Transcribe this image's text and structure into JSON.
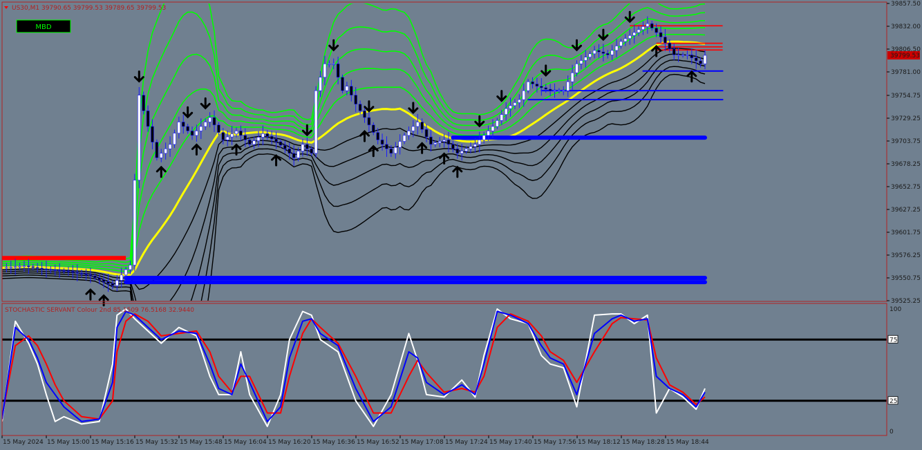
{
  "header": {
    "symbol_line": "US30,M1  39790.65 39799.53 39789.65 39799.53",
    "mbd_button": "MBD",
    "indicator_label": "STOCHASTIC SERVANT Colour 2nd 85.1509 76.5168 32.9440"
  },
  "colors": {
    "background": "#708090",
    "frame": "#b22222",
    "band_upper": "#00ff00",
    "band_mid": "#ffff00",
    "band_lower": "#000000",
    "candle": "#1a1aff",
    "level_blue": "#0000ff",
    "level_red": "#ff0000",
    "stoch_main": "#0000ff",
    "stoch_signal": "#ff0000",
    "stoch_raw": "#ffffff"
  },
  "chart_data": [
    {
      "type": "line",
      "title": "",
      "ylim": [
        39525.25,
        39857.5
      ],
      "y_ticks": [
        "39857.50",
        "39832.00",
        "39806.50",
        "39781.00",
        "39754.75",
        "39729.25",
        "39703.75",
        "39678.25",
        "39652.75",
        "39627.25",
        "39601.75",
        "39576.25",
        "39550.75",
        "39525.25"
      ],
      "x_ticks": [
        "15 May 2024",
        "15 May 15:00",
        "15 May 15:16",
        "15 May 15:32",
        "15 May 15:48",
        "15 May 16:04",
        "15 May 16:20",
        "15 May 16:36",
        "15 May 16:52",
        "15 May 17:08",
        "15 May 17:24",
        "15 May 17:40",
        "15 May 17:56",
        "15 May 18:12",
        "15 May 18:28",
        "15 May 18:44"
      ],
      "current_price": "39799.53",
      "price_path": {
        "x": [
          0,
          5,
          10,
          15,
          20,
          25,
          28,
          29,
          31,
          33,
          35,
          38,
          40,
          43,
          47,
          50,
          53,
          56,
          59,
          62,
          64,
          66,
          68,
          70,
          71,
          73,
          75,
          77,
          78,
          80,
          82,
          85,
          88,
          91,
          94,
          97,
          100,
          103,
          107,
          111,
          114,
          117,
          119,
          121,
          124,
          127,
          130,
          134,
          137,
          140,
          143,
          146,
          149,
          152,
          155,
          158,
          159
        ],
        "close": [
          39562,
          39564,
          39560,
          39558,
          39553,
          39542,
          39560,
          39565,
          39755,
          39720,
          39685,
          39700,
          39725,
          39710,
          39730,
          39705,
          39715,
          39700,
          39712,
          39703,
          39695,
          39685,
          39700,
          39690,
          39760,
          39790,
          39790,
          39760,
          39765,
          39745,
          39730,
          39705,
          39690,
          39710,
          39725,
          39700,
          39705,
          39690,
          39700,
          39720,
          39740,
          39750,
          39770,
          39765,
          39760,
          39760,
          39790,
          39805,
          39800,
          39815,
          39825,
          39835,
          39820,
          39800,
          39800,
          39790,
          39799.53
        ]
      },
      "bands_upper": [
        1.0,
        0.78,
        0.58,
        0.4,
        0.22
      ],
      "band_mid": 0,
      "bands_lower": [
        -0.2,
        -0.38,
        -0.56,
        -0.76,
        -1.0
      ],
      "levels_blue": [
        {
          "price": 39550.75,
          "x_from": 28,
          "x_to": 159
        },
        {
          "price": 39546.0,
          "x_from": 28,
          "x_to": 159
        },
        {
          "price": 39707.5,
          "x_from": 102,
          "x_to": 159
        },
        {
          "price": 39750.0,
          "x_from": 119,
          "x_to": 163
        },
        {
          "price": 39760.0,
          "x_from": 122,
          "x_to": 163
        },
        {
          "price": 39782.0,
          "x_from": 145,
          "x_to": 163
        }
      ],
      "levels_red": [
        {
          "price": 39573.0,
          "x_from": 0,
          "x_to": 28
        },
        {
          "price": 39832.5,
          "x_from": 142,
          "x_to": 163
        },
        {
          "price": 39813.0,
          "x_from": 148,
          "x_to": 163
        },
        {
          "price": 39809.0,
          "x_from": 148,
          "x_to": 163
        },
        {
          "price": 39805.5,
          "x_from": 148,
          "x_to": 163
        }
      ],
      "arrows_down": [
        31,
        42,
        46,
        69,
        75,
        83,
        93,
        108,
        113,
        123,
        130,
        136,
        142
      ],
      "arrows_up": [
        20,
        23,
        36,
        44,
        53,
        62,
        82,
        84,
        95,
        100,
        103,
        148,
        156
      ]
    },
    {
      "type": "line",
      "title": "",
      "ylim": [
        0,
        100
      ],
      "y_ticks": [
        "100",
        "75",
        "25",
        "0"
      ],
      "levels": [
        75,
        25
      ],
      "series": [
        {
          "x": [
            0,
            3,
            6,
            8,
            10,
            12,
            14,
            18,
            22,
            25,
            26,
            28,
            30,
            33,
            36,
            40,
            44,
            47,
            49,
            52,
            54,
            56,
            60,
            63,
            65,
            68,
            70,
            72,
            76,
            80,
            84,
            88,
            92,
            94,
            96,
            100,
            104,
            107,
            109,
            112,
            115,
            119,
            122,
            124,
            127,
            130,
            134,
            138,
            140,
            143,
            146,
            148,
            151,
            154,
            157,
            159
          ],
          "values": [
            10,
            85,
            75,
            60,
            40,
            30,
            20,
            8,
            10,
            40,
            85,
            98,
            95,
            85,
            75,
            82,
            80,
            55,
            35,
            30,
            55,
            40,
            8,
            20,
            60,
            90,
            92,
            80,
            70,
            35,
            8,
            20,
            65,
            60,
            40,
            30,
            38,
            30,
            55,
            98,
            95,
            88,
            70,
            60,
            55,
            30,
            80,
            92,
            95,
            90,
            92,
            45,
            35,
            30,
            20,
            32
          ]
        },
        {
          "x": [
            0,
            3,
            6,
            8,
            10,
            12,
            14,
            18,
            22,
            25,
            26,
            28,
            30,
            33,
            36,
            40,
            44,
            47,
            49,
            52,
            54,
            56,
            60,
            63,
            65,
            68,
            70,
            72,
            76,
            80,
            84,
            88,
            92,
            94,
            96,
            100,
            104,
            107,
            109,
            112,
            115,
            119,
            122,
            124,
            127,
            130,
            134,
            138,
            140,
            143,
            146,
            148,
            151,
            154,
            157,
            159
          ],
          "values": [
            12,
            70,
            78,
            70,
            55,
            38,
            25,
            12,
            10,
            25,
            65,
            90,
            96,
            90,
            78,
            80,
            82,
            65,
            45,
            32,
            45,
            45,
            15,
            15,
            45,
            80,
            92,
            85,
            72,
            45,
            15,
            15,
            45,
            58,
            48,
            32,
            35,
            32,
            45,
            85,
            96,
            90,
            78,
            65,
            58,
            40,
            65,
            88,
            93,
            92,
            91,
            60,
            38,
            32,
            22,
            28
          ]
        },
        {
          "x": [
            0,
            3,
            6,
            8,
            10,
            12,
            14,
            18,
            22,
            25,
            26,
            28,
            30,
            33,
            36,
            40,
            44,
            47,
            49,
            52,
            54,
            56,
            60,
            63,
            65,
            68,
            70,
            72,
            76,
            80,
            84,
            88,
            92,
            94,
            96,
            100,
            104,
            107,
            109,
            112,
            115,
            119,
            122,
            124,
            127,
            130,
            134,
            138,
            140,
            143,
            146,
            148,
            151,
            154,
            157,
            159
          ],
          "values": [
            8,
            90,
            72,
            55,
            30,
            8,
            12,
            6,
            8,
            55,
            95,
            100,
            92,
            82,
            72,
            85,
            78,
            45,
            30,
            30,
            65,
            30,
            4,
            30,
            75,
            98,
            95,
            75,
            65,
            25,
            4,
            30,
            80,
            58,
            30,
            28,
            42,
            28,
            62,
            100,
            92,
            88,
            62,
            55,
            52,
            20,
            95,
            96,
            96,
            88,
            95,
            15,
            35,
            28,
            18,
            35
          ]
        }
      ]
    }
  ]
}
